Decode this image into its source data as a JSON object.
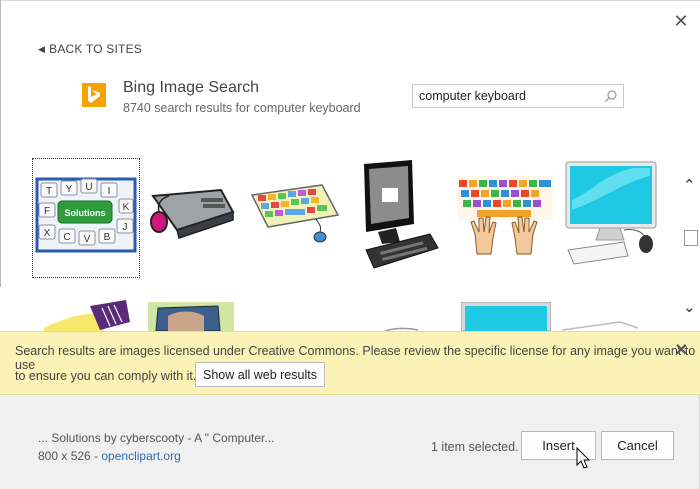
{
  "nav": {
    "back_label": "BACK TO SITES"
  },
  "provider": {
    "title": "Bing Image Search",
    "subtitle": "8740 search results for computer keyboard",
    "logo_icon": "bing-logo-icon",
    "brand_color": "#f4a300"
  },
  "search": {
    "query": "computer keyboard"
  },
  "results": [
    {
      "name": "result-solutions-keyboard",
      "selected": true
    },
    {
      "name": "result-keyboard-mouse-gray",
      "selected": false
    },
    {
      "name": "result-colorful-keyboard",
      "selected": false
    },
    {
      "name": "result-computer-monitor-bw",
      "selected": false
    },
    {
      "name": "result-keyboard-hands",
      "selected": false
    },
    {
      "name": "result-cyan-monitor",
      "selected": false
    },
    {
      "name": "result-row2-1",
      "selected": false
    },
    {
      "name": "result-row2-2",
      "selected": false
    },
    {
      "name": "result-row2-3",
      "selected": false
    },
    {
      "name": "result-row2-4",
      "selected": false
    }
  ],
  "notice": {
    "line1": "Search results are images licensed under Creative Commons. Please review the specific license for any image you want to use",
    "line2": "to ensure you can comply with it.",
    "button": "Show all web results"
  },
  "footer": {
    "caption": "... Solutions by cyberscooty - A \"   Computer...",
    "dims": "800 x 526 - ",
    "source": "openclipart.org",
    "status": "1 item selected.",
    "insert": "Insert",
    "cancel": "Cancel"
  }
}
